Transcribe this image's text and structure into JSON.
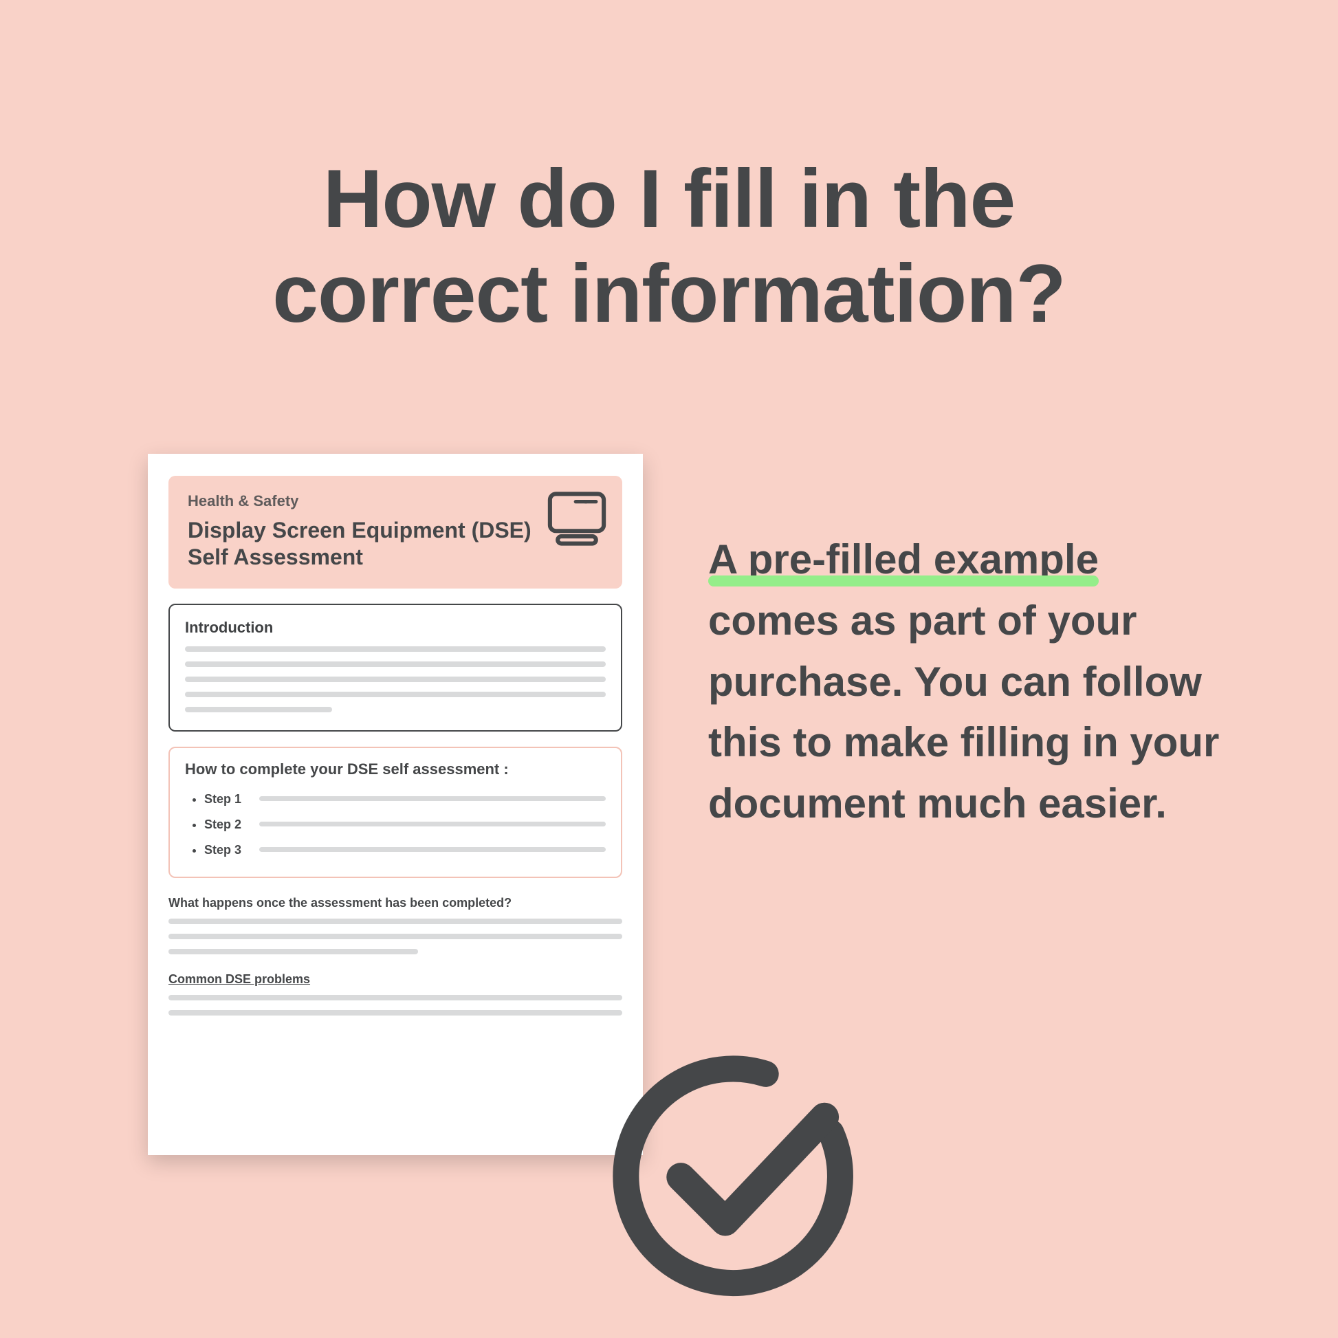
{
  "heading_line1": "How do I fill in the",
  "heading_line2": "correct information?",
  "copy": {
    "highlight": "A pre-filled example",
    "rest": " comes as part of your purchase. You can follow this to make filling in your document much easier."
  },
  "doc": {
    "kicker": "Health & Safety",
    "title": "Display Screen Equipment (DSE) Self Assessment",
    "intro_label": "Introduction",
    "steps_label": "How to complete your DSE self assessment :",
    "steps": [
      "Step 1",
      "Step 2",
      "Step 3"
    ],
    "section_a": "What happens once the assessment has been completed?",
    "section_b": "Common DSE problems"
  }
}
